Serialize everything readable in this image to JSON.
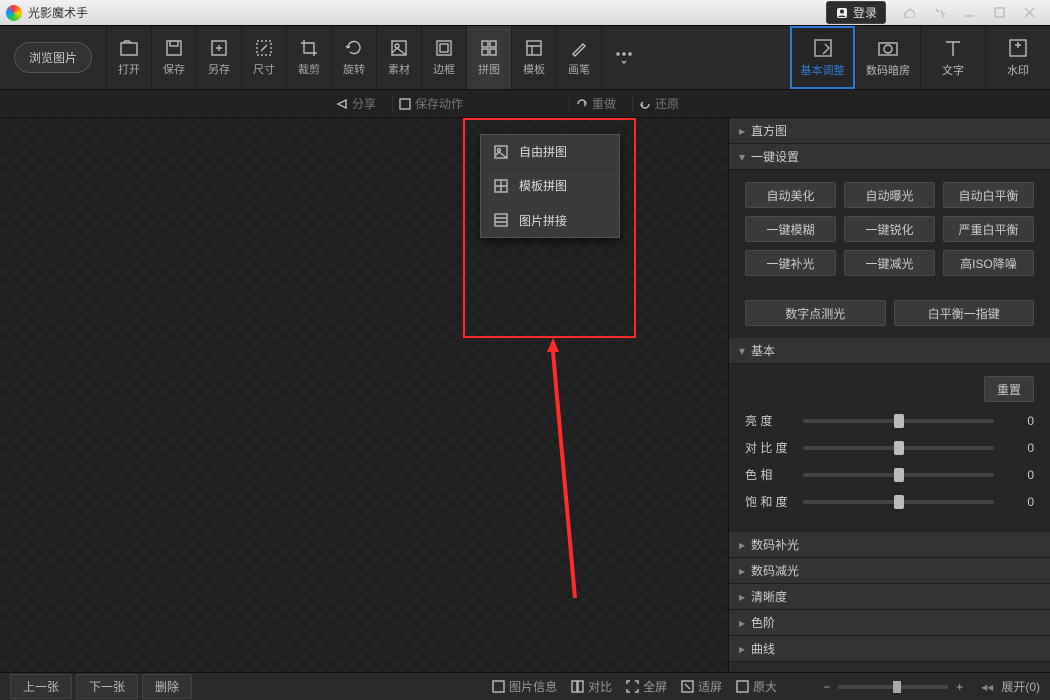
{
  "title": "光影魔术手",
  "login": {
    "label": "登录"
  },
  "toolbar": {
    "browse": "浏览图片",
    "items": [
      {
        "label": "打开"
      },
      {
        "label": "保存"
      },
      {
        "label": "另存"
      },
      {
        "label": "尺寸"
      },
      {
        "label": "裁剪"
      },
      {
        "label": "旋转"
      },
      {
        "label": "素材"
      },
      {
        "label": "边框"
      },
      {
        "label": "拼图"
      },
      {
        "label": "模板"
      },
      {
        "label": "画笔"
      },
      {
        "label": "..."
      }
    ],
    "rtabs": [
      {
        "label": "基本调整"
      },
      {
        "label": "数码暗房"
      },
      {
        "label": "文字"
      },
      {
        "label": "水印"
      }
    ]
  },
  "subbar": {
    "share": "分享",
    "saveAction": "保存动作",
    "redo": "重做",
    "restore": "还原"
  },
  "dropdown": {
    "items": [
      "自由拼图",
      "模板拼图",
      "图片拼接"
    ]
  },
  "side": {
    "sec1": "直方图",
    "sec2": {
      "title": "一键设置",
      "btns": [
        "自动美化",
        "自动曝光",
        "自动白平衡",
        "一键模糊",
        "一键锐化",
        "严重白平衡",
        "一键补光",
        "一键减光",
        "高ISO降噪"
      ],
      "btns2": [
        "数字点测光",
        "白平衡一指键"
      ]
    },
    "sec3": {
      "title": "基本",
      "reset": "重置",
      "sliders": [
        {
          "name": "亮    度",
          "val": "0"
        },
        {
          "name": "对 比 度",
          "val": "0"
        },
        {
          "name": "色    相",
          "val": "0"
        },
        {
          "name": "饱 和 度",
          "val": "0"
        }
      ]
    },
    "more": [
      "数码补光",
      "数码减光",
      "清晰度",
      "色阶",
      "曲线"
    ]
  },
  "bottom": {
    "left": [
      "上一张",
      "下一张",
      "删除"
    ],
    "center": [
      "图片信息",
      "对比",
      "全屏",
      "适屏",
      "原大"
    ],
    "expand": "展开(0)"
  }
}
